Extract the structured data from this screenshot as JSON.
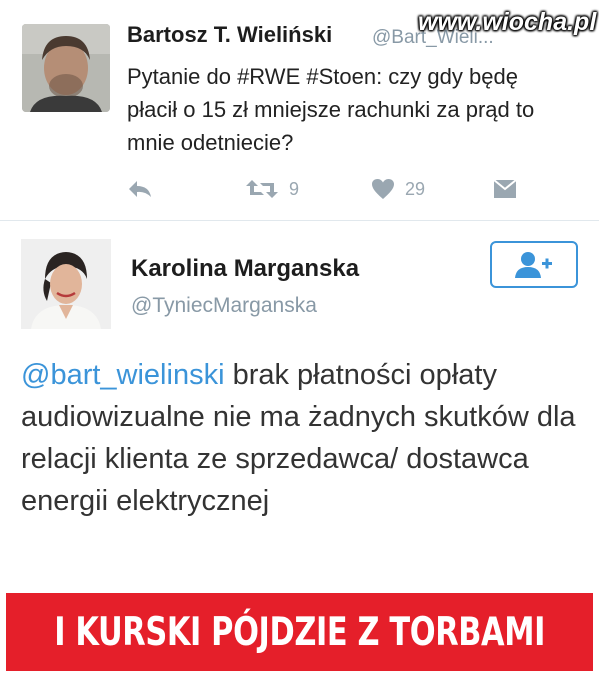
{
  "watermark": "www.wiocha.pl",
  "tweet1": {
    "author_name": "Bartosz T. Wieliński",
    "author_handle": "@Bart_Wieli...",
    "text": "Pytanie do #RWE #Stoen: czy gdy będę płacił o 15 zł mniejsze rachunki za prąd to mnie odetniecie?",
    "retweets": "9",
    "likes": "29",
    "icons": [
      "reply-icon",
      "retweet-icon",
      "heart-icon",
      "message-icon"
    ]
  },
  "tweet2": {
    "author_name": "Karolina Marganska",
    "author_handle": "@TyniecMarganska",
    "mention": "@bart_wielinski",
    "text": " brak płatności opłaty audiowizualne nie ma żadnych skutków dla relacji klienta ze sprzedawca/ dostawca energii elektrycznej",
    "follow_icon": "add-user-icon"
  },
  "banner": {
    "text": "I KURSKI PÓJDZIE Z TORBAMI"
  },
  "colors": {
    "accent": "#3b94d9",
    "muted": "#8899a6",
    "banner": "#e51f2a"
  }
}
